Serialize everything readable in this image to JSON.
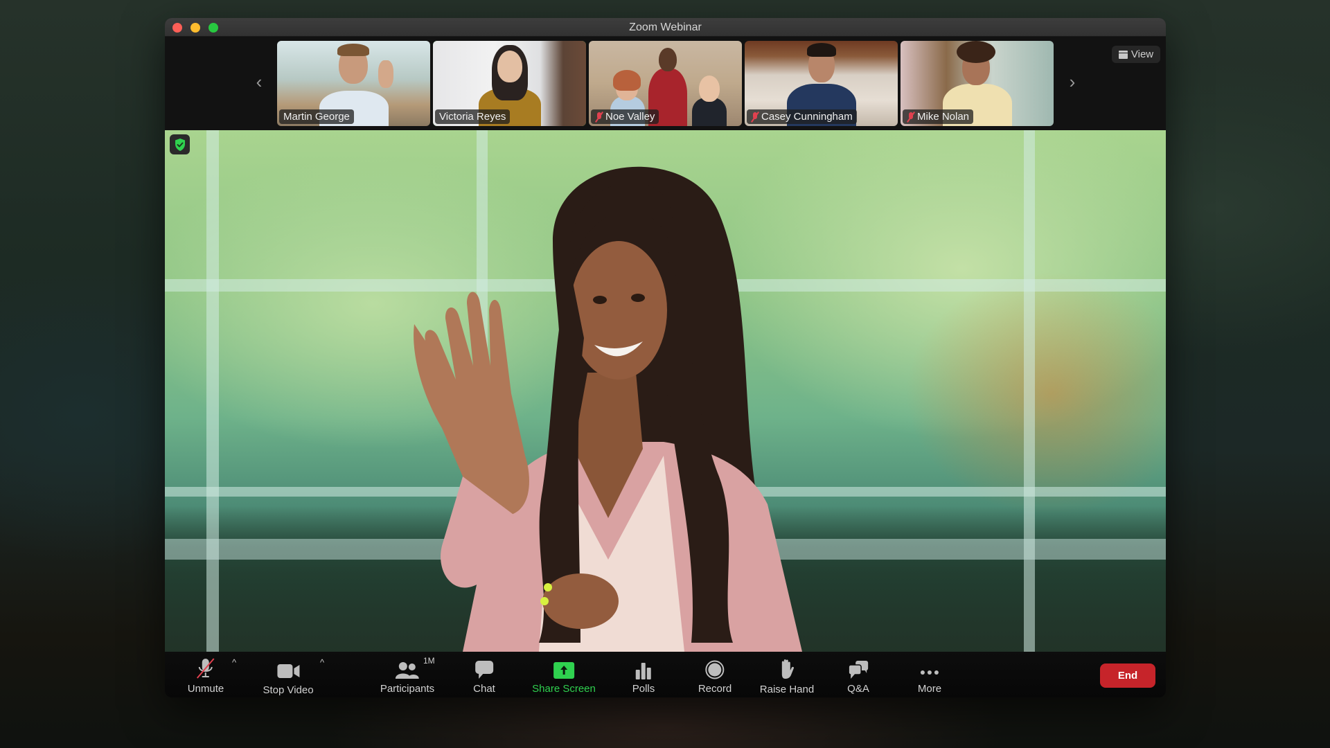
{
  "window": {
    "title": "Zoom Webinar",
    "traffic_lights": [
      "close",
      "minimize",
      "maximize"
    ]
  },
  "strip": {
    "prev_icon": "chevron-left-icon",
    "next_icon": "chevron-right-icon",
    "view_button": {
      "label": "View",
      "icon": "grid-view-icon"
    },
    "participants": [
      {
        "name": "Martin George",
        "muted": false,
        "active": false
      },
      {
        "name": "Victoria Reyes",
        "muted": false,
        "active": true
      },
      {
        "name": "Noe Valley",
        "muted": true,
        "active": false
      },
      {
        "name": "Casey Cunningham",
        "muted": true,
        "active": false
      },
      {
        "name": "Mike Nolan",
        "muted": true,
        "active": false
      }
    ]
  },
  "main_video": {
    "security_icon": "shield-check-icon"
  },
  "colors": {
    "accent_green": "#2fd14f",
    "end_red": "#c6242a",
    "muted_red": "#e0414f"
  },
  "toolbar": {
    "unmute": {
      "label": "Unmute",
      "icon": "mic-muted-icon"
    },
    "stop_video": {
      "label": "Stop Video",
      "icon": "video-camera-icon"
    },
    "participants": {
      "label": "Participants",
      "icon": "participants-icon",
      "count": "1M"
    },
    "chat": {
      "label": "Chat",
      "icon": "chat-bubble-icon"
    },
    "share_screen": {
      "label": "Share Screen",
      "icon": "share-screen-icon"
    },
    "polls": {
      "label": "Polls",
      "icon": "bar-chart-icon"
    },
    "record": {
      "label": "Record",
      "icon": "record-icon"
    },
    "raise_hand": {
      "label": "Raise Hand",
      "icon": "hand-icon"
    },
    "qa": {
      "label": "Q&A",
      "icon": "qa-bubbles-icon"
    },
    "more": {
      "label": "More",
      "icon": "ellipsis-icon"
    },
    "end": {
      "label": "End"
    },
    "caret": "^"
  }
}
